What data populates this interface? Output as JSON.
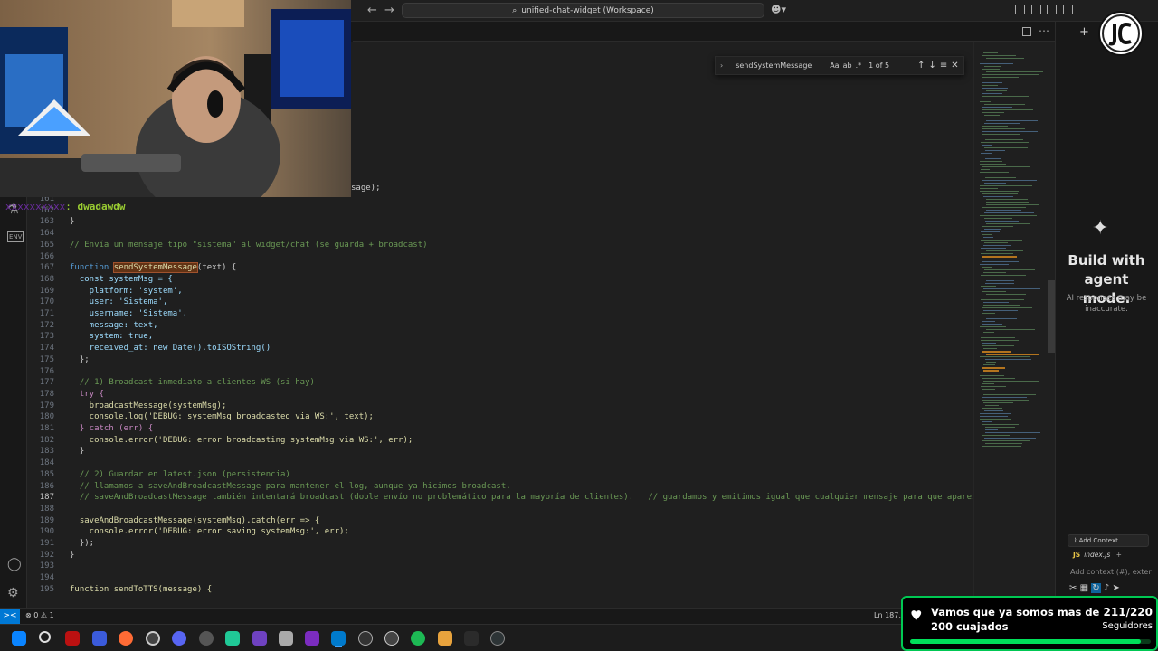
{
  "titlebar": {
    "search_text": "unified-chat-widget (Workspace)",
    "back_icon": "arrow-left-icon",
    "forward_icon": "arrow-right-icon"
  },
  "find": {
    "query": "sendSystemMessage",
    "opt_case": "Aa",
    "opt_word": "ab",
    "opt_regex": ".*",
    "count": "1 of 5"
  },
  "partial_line": "sage);",
  "code": [
    {
      "n": "161",
      "text": ""
    },
    {
      "n": "162",
      "text": ""
    },
    {
      "n": "163",
      "text": "}"
    },
    {
      "n": "164",
      "text": ""
    },
    {
      "n": "165",
      "text": "// Envía un mensaje tipo \"sistema\" al widget/chat (se guarda + broadcast)"
    },
    {
      "n": "166",
      "text": ""
    },
    {
      "n": "167",
      "text": "function sendSystemMessage(text) {"
    },
    {
      "n": "168",
      "text": "  const systemMsg = {"
    },
    {
      "n": "169",
      "text": "    platform: 'system',"
    },
    {
      "n": "170",
      "text": "    user: 'Sistema',"
    },
    {
      "n": "171",
      "text": "    username: 'Sistema',"
    },
    {
      "n": "172",
      "text": "    message: text,"
    },
    {
      "n": "173",
      "text": "    system: true,"
    },
    {
      "n": "174",
      "text": "    received_at: new Date().toISOString()"
    },
    {
      "n": "175",
      "text": "  };"
    },
    {
      "n": "176",
      "text": ""
    },
    {
      "n": "177",
      "text": "  // 1) Broadcast inmediato a clientes WS (si hay)"
    },
    {
      "n": "178",
      "text": "  try {"
    },
    {
      "n": "179",
      "text": "    broadcastMessage(systemMsg);"
    },
    {
      "n": "180",
      "text": "    console.log('DEBUG: systemMsg broadcasted via WS:', text);"
    },
    {
      "n": "181",
      "text": "  } catch (err) {"
    },
    {
      "n": "182",
      "text": "    console.error('DEBUG: error broadcasting systemMsg via WS:', err);"
    },
    {
      "n": "183",
      "text": "  }"
    },
    {
      "n": "184",
      "text": ""
    },
    {
      "n": "185",
      "text": "  // 2) Guardar en latest.json (persistencia)"
    },
    {
      "n": "186",
      "text": "  // llamamos a saveAndBroadcastMessage para mantener el log, aunque ya hicimos broadcast."
    },
    {
      "n": "187",
      "text": "  // saveAndBroadcastMessage también intentará broadcast (doble envío no problemático para la mayoría de clientes).   // guardamos y emitimos igual que cualquier mensaje para que aparezca en el c"
    },
    {
      "n": "188",
      "text": ""
    },
    {
      "n": "189",
      "text": "  saveAndBroadcastMessage(systemMsg).catch(err => {"
    },
    {
      "n": "190",
      "text": "    console.error('DEBUG: error saving systemMsg:', err);"
    },
    {
      "n": "191",
      "text": "  });"
    },
    {
      "n": "192",
      "text": "}"
    },
    {
      "n": "193",
      "text": ""
    },
    {
      "n": "194",
      "text": ""
    },
    {
      "n": "195",
      "text": "function sendToTTS(message) {"
    }
  ],
  "chat_panel": {
    "title": "Build with agent mode.",
    "subtitle": "AI responses may be inaccurate.",
    "add_context": "Add Context...",
    "file": "index.js",
    "file_badge": "JS",
    "input_placeholder": "Add context (#), exter"
  },
  "statusbar": {
    "remote": "><",
    "problems": "⊗ 0 ⚠ 1",
    "position": "Ln 187, C"
  },
  "overlay": {
    "chat_user": "xxxxxxxxxx",
    "chat_sep": ":",
    "chat_text": "dwadawdw"
  },
  "goal": {
    "text": "Vamos que ya somos mas de 200 cuajados",
    "count": "211/220",
    "label": "Seguidores",
    "progress": 0.959,
    "color": "#00e05a"
  },
  "colors": {
    "accent": "#0078d4",
    "goal_border": "#00c853",
    "highlight": "#623315"
  }
}
